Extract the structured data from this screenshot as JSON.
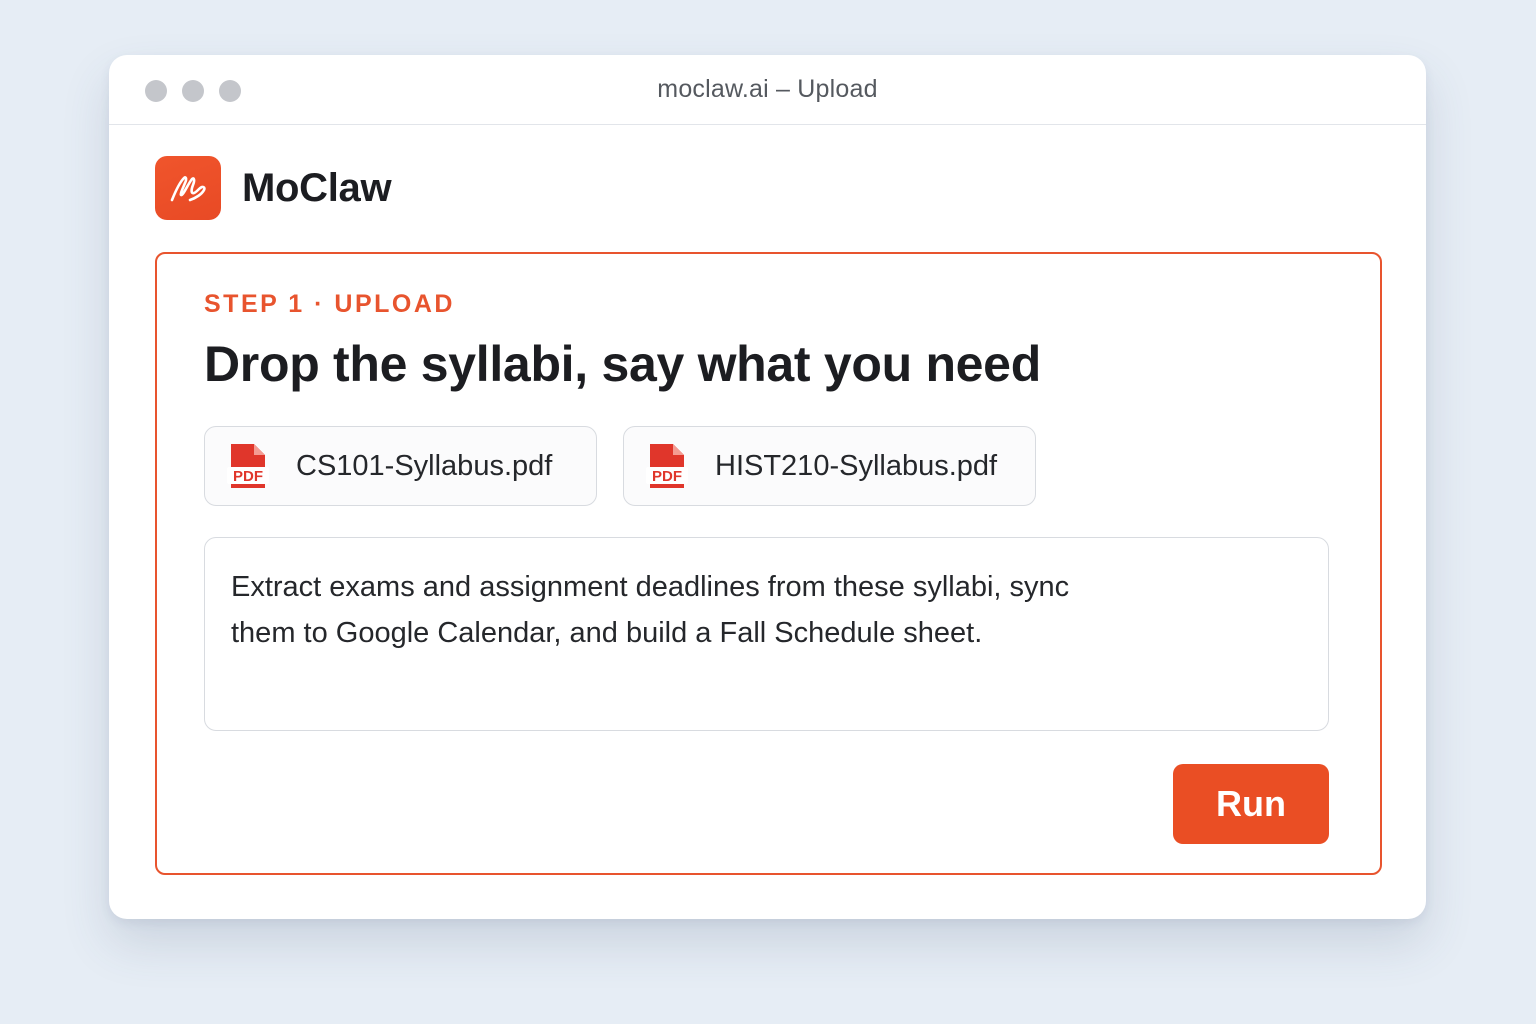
{
  "window": {
    "title": "moclaw.ai – Upload"
  },
  "brand": {
    "name": "MoClaw",
    "logo_icon": "scribble-logo-icon",
    "accent_color": "#e8542e"
  },
  "upload_card": {
    "step_label": "STEP 1 · UPLOAD",
    "heading": "Drop the syllabi, say what you need",
    "files": [
      {
        "name": "CS101-Syllabus.pdf",
        "icon": "pdf-icon",
        "icon_label": "PDF"
      },
      {
        "name": "HIST210-Syllabus.pdf",
        "icon": "pdf-icon",
        "icon_label": "PDF"
      }
    ],
    "prompt_text": "Extract exams and assignment deadlines from these syllabi, sync\nthem to Google Calendar, and build a Fall Schedule sheet.",
    "run_label": "Run"
  }
}
